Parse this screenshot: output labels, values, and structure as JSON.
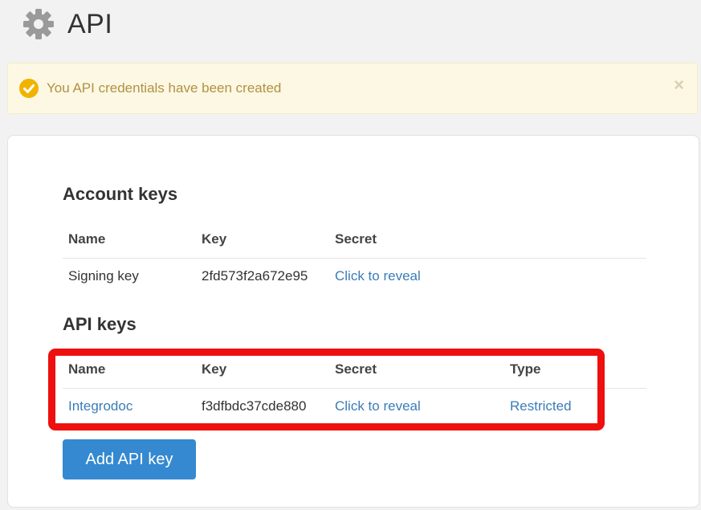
{
  "page": {
    "title": "API",
    "icon": "gear-icon"
  },
  "alert": {
    "icon": "check-circle-icon",
    "message": "You API credentials have been created",
    "close_label": "×",
    "color": "#b19145",
    "background": "#fcf8e3"
  },
  "account_keys": {
    "title": "Account keys",
    "columns": [
      "Name",
      "Key",
      "Secret"
    ],
    "rows": [
      {
        "name": "Signing key",
        "key": "2fd573f2a672e95",
        "secret": "Click to reveal"
      }
    ]
  },
  "api_keys": {
    "title": "API keys",
    "columns": [
      "Name",
      "Key",
      "Secret",
      "Type"
    ],
    "rows": [
      {
        "name": "Integrodoc",
        "key": "f3dfbdc37cde880",
        "secret": "Click to reveal",
        "type": "Restricted"
      }
    ]
  },
  "add_button": {
    "label": "Add API key",
    "color": "#3589d0"
  },
  "colors": {
    "link": "#3a7cb9",
    "highlight": "#ee0f0f"
  }
}
